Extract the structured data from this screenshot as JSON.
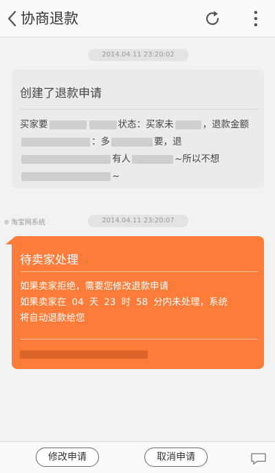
{
  "header": {
    "title": "协商退款",
    "back_icon": "chevron-left-icon",
    "refresh_icon": "refresh-icon",
    "more_icon": "more-vertical-icon"
  },
  "messages": [
    {
      "timestamp": "2014.04.11 23:20:02",
      "title": "创建了退款申请",
      "body_parts": [
        "买家要",
        "状态：买家未",
        "，退款金额",
        "：多",
        "要，退",
        "有人",
        "~所以不想",
        "~"
      ]
    },
    {
      "timestamp": "2014.04.11 23:20:07",
      "sender": "淘宝网系统",
      "title": "待卖家处理",
      "line1": "如果卖家拒绝，需要您修改退款申请",
      "line2_prefix": "如果卖家在",
      "days": "04",
      "days_label": "天",
      "hours": "23",
      "hours_label": "时",
      "minutes": "58",
      "line2_suffix": "分内未处理，系统",
      "line3": "将自动退款给您"
    }
  ],
  "footer": {
    "modify_label": "修改申请",
    "cancel_label": "取消申请",
    "chat_icon": "chat-icon"
  },
  "colors": {
    "accent": "#fd7c39",
    "background": "#f2f2f2"
  }
}
